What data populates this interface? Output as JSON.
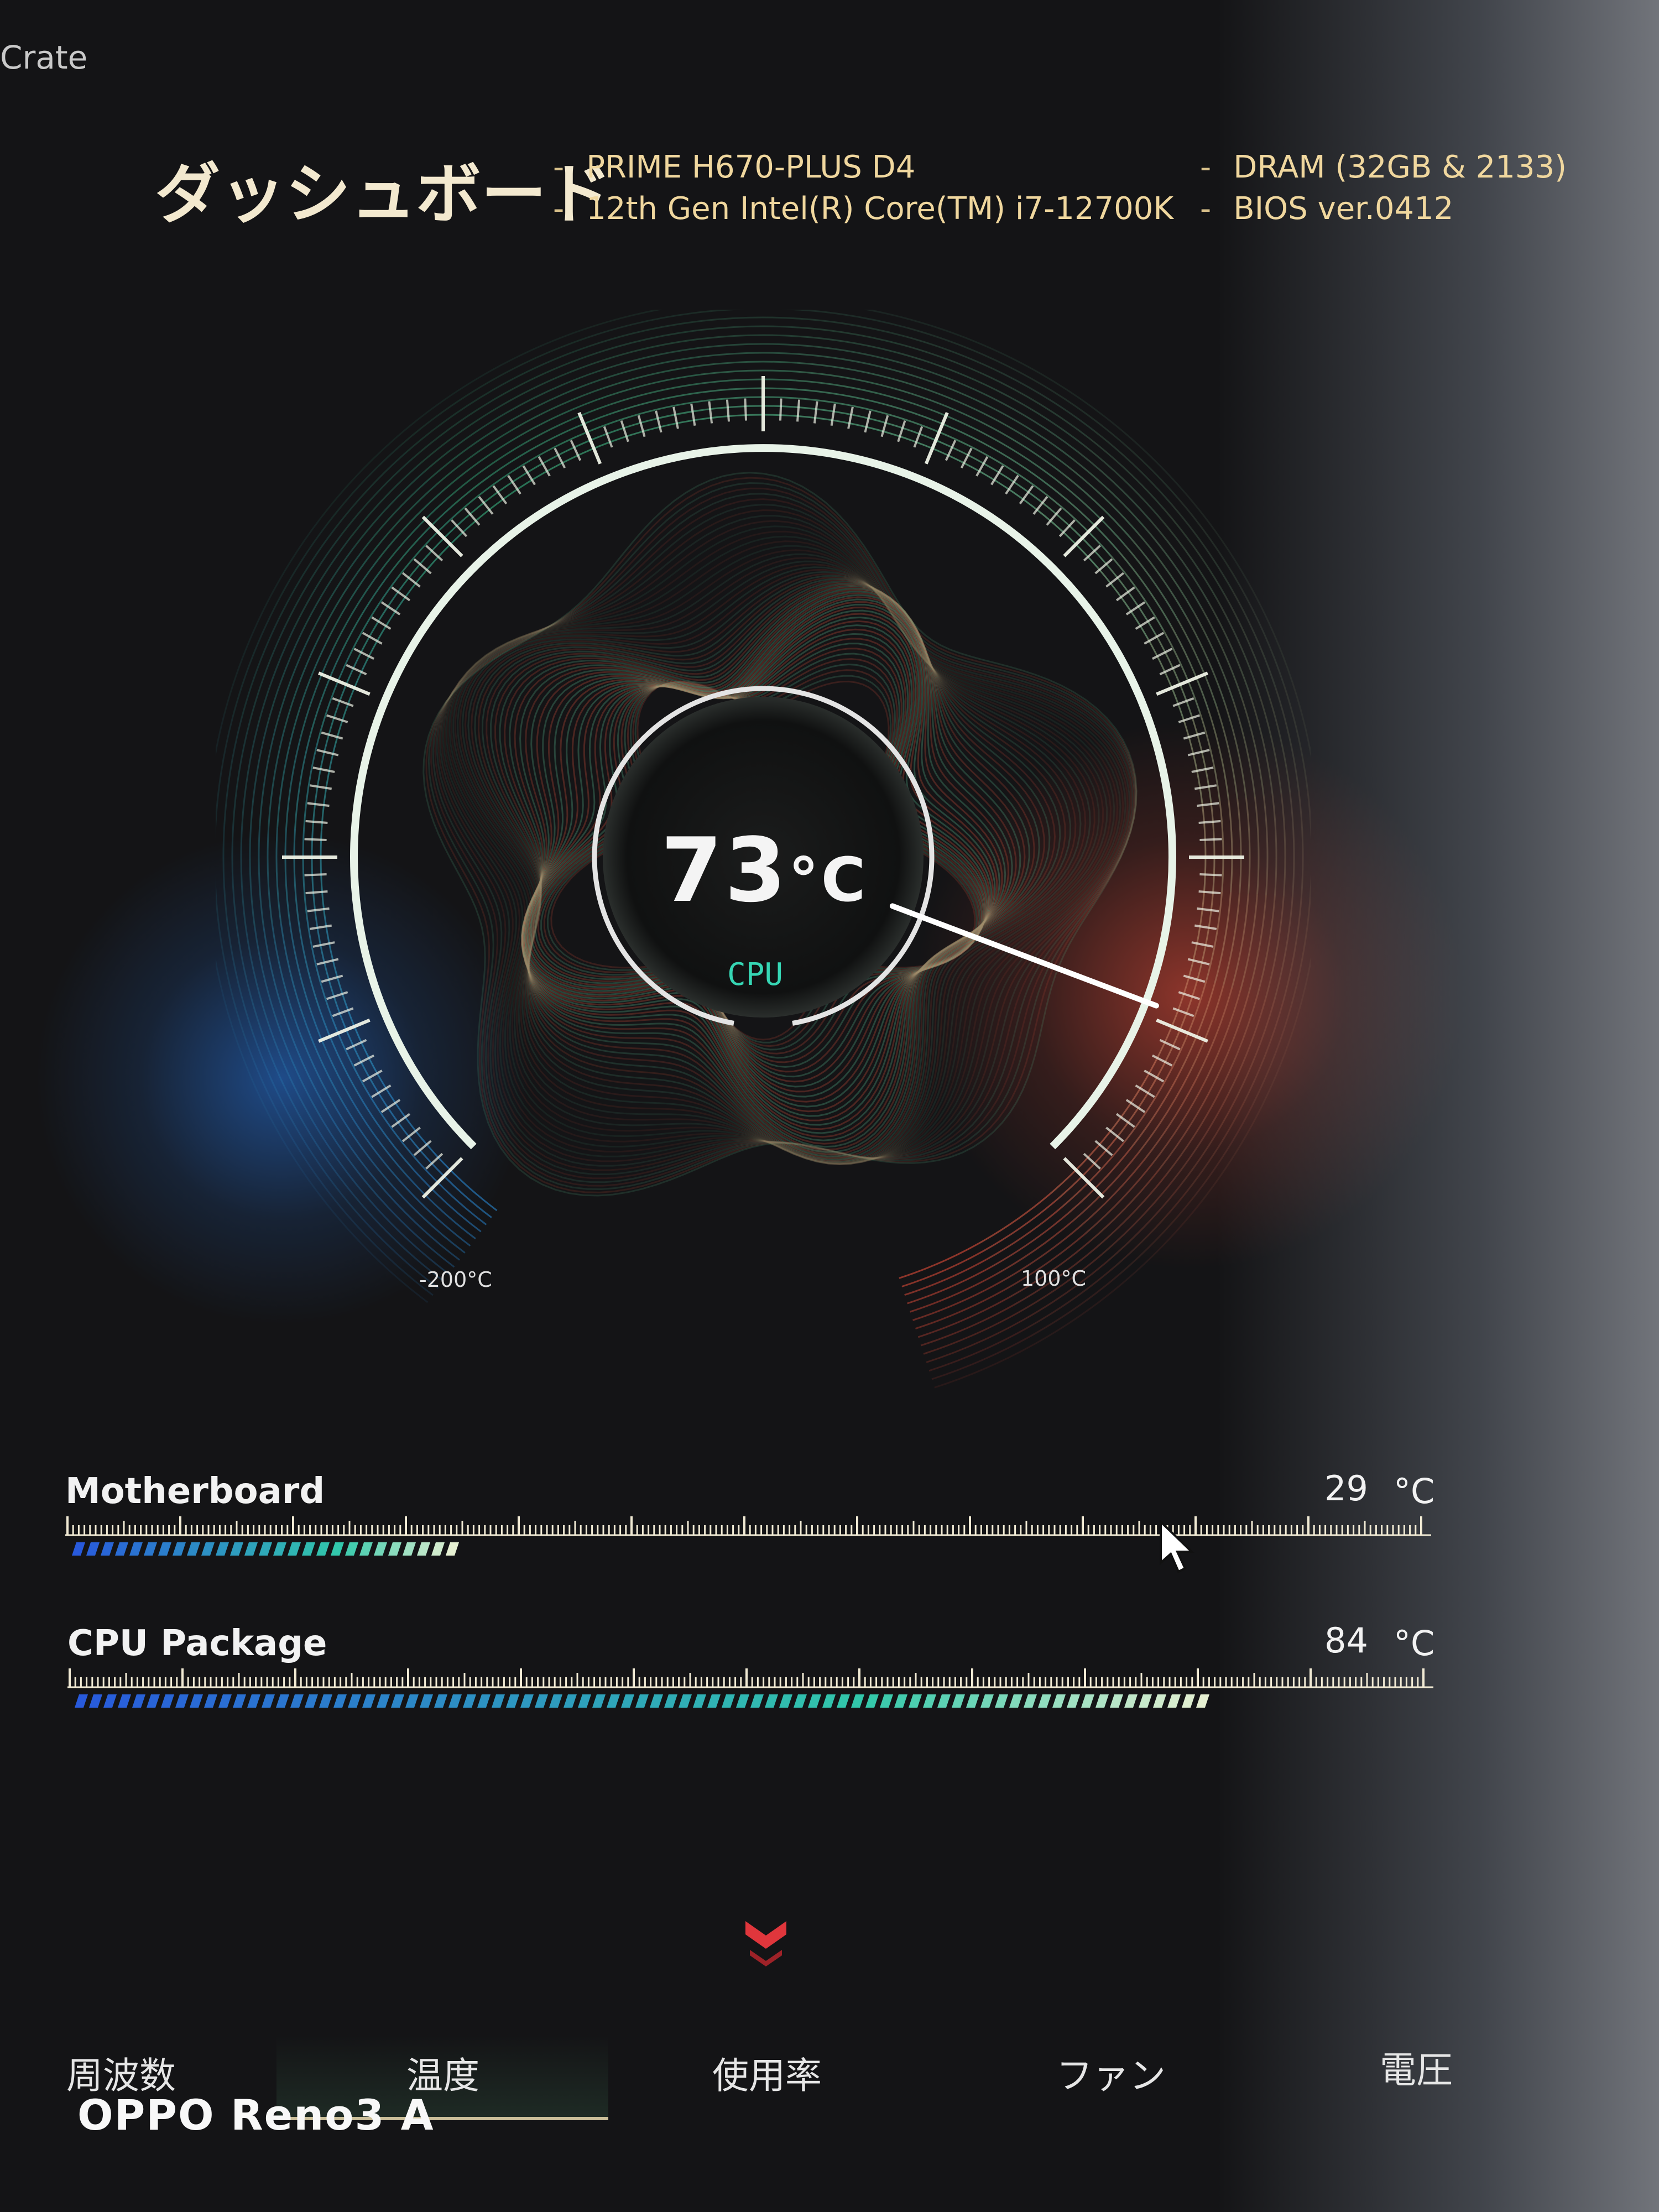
{
  "app_title": "Crate",
  "header": {
    "title": "ダッシュボード",
    "specs": [
      "PRIME H670-PLUS D4",
      "12th Gen Intel(R) Core(TM) i7-12700K",
      "DRAM (32GB & 2133)",
      "BIOS ver.0412"
    ],
    "dash": "-"
  },
  "gauge": {
    "value": "73",
    "unit": "°C",
    "label": "CPU",
    "min_label": "-200°C",
    "max_label": "100°C",
    "min": -200,
    "max": 100,
    "current": 73
  },
  "sensors": [
    {
      "name": "Motherboard",
      "value": "29",
      "unit": "°C",
      "fill_fraction": 0.29
    },
    {
      "name": "CPU Package",
      "value": "84",
      "unit": "°C",
      "fill_fraction": 0.84
    }
  ],
  "tabs": [
    {
      "label": "周波数",
      "active": false
    },
    {
      "label": "温度",
      "active": true
    },
    {
      "label": "使用率",
      "active": false
    },
    {
      "label": "ファン",
      "active": false
    },
    {
      "label": "電圧",
      "active": false
    }
  ],
  "watermark": "OPPO Reno3 A",
  "colors": {
    "accent_gold": "#f0d79e",
    "cpu_label": "#36d6b4",
    "hot": "#f0503c",
    "cold": "#2878e6",
    "collapse": "#e0363c"
  },
  "icons": {
    "collapse": "chevron-down-double-icon",
    "cursor": "mouse-cursor-icon"
  }
}
